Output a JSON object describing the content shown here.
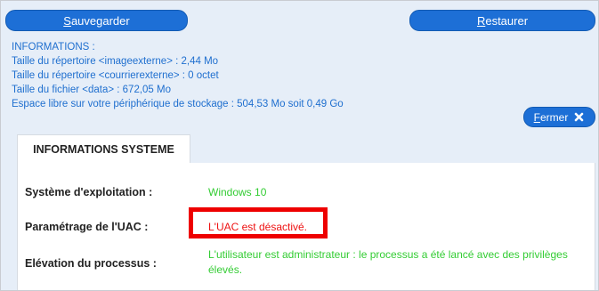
{
  "toolbar": {
    "save_first": "S",
    "save_rest": "auvegarder",
    "restore_first": "R",
    "restore_rest": "estaurer"
  },
  "info": {
    "heading": "INFORMATIONS :",
    "lines": [
      "Taille du répertoire <imageexterne> : 2,44 Mo",
      "Taille du répertoire <courrierexterne> : 0 octet",
      "Taille du fichier <data> : 672,05 Mo",
      "Espace libre sur votre périphérique de stockage : 504,53 Mo soit 0,49 Go"
    ]
  },
  "close": {
    "first": "F",
    "rest": "ermer",
    "icon": "close-x-icon"
  },
  "tab": {
    "label": "INFORMATIONS SYSTEME"
  },
  "system": {
    "os_label": "Système d'exploitation :",
    "os_value": "Windows 10",
    "uac_label": "Paramétrage de l'UAC :",
    "uac_value": "L'UAC est désactivé.",
    "elevation_label": "Elévation du processus :",
    "elevation_value": "L'utilisateur est administrateur : le processus a été lancé avec des privilèges élevés."
  },
  "colors": {
    "button": "#1d6fd6",
    "info_text": "#1f6fcf",
    "ok_text": "#33cc33",
    "warn_text": "#ee1111",
    "highlight": "#ee0000",
    "background": "#e6eef8"
  }
}
